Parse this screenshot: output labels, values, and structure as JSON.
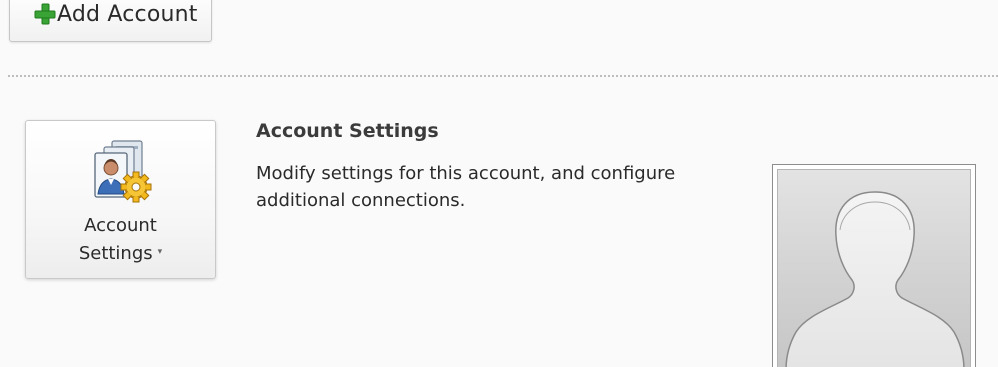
{
  "add_account": {
    "label": "Add Account",
    "icon": "green-plus-icon",
    "color": "#3aa335"
  },
  "account_settings": {
    "button_line1": "Account",
    "button_line2": "Settings",
    "caret": "▾",
    "icon": "account-settings-icon",
    "title": "Account Settings",
    "description": "Modify settings for this account, and configure additional connections."
  },
  "avatar": {
    "icon": "default-person-silhouette"
  }
}
